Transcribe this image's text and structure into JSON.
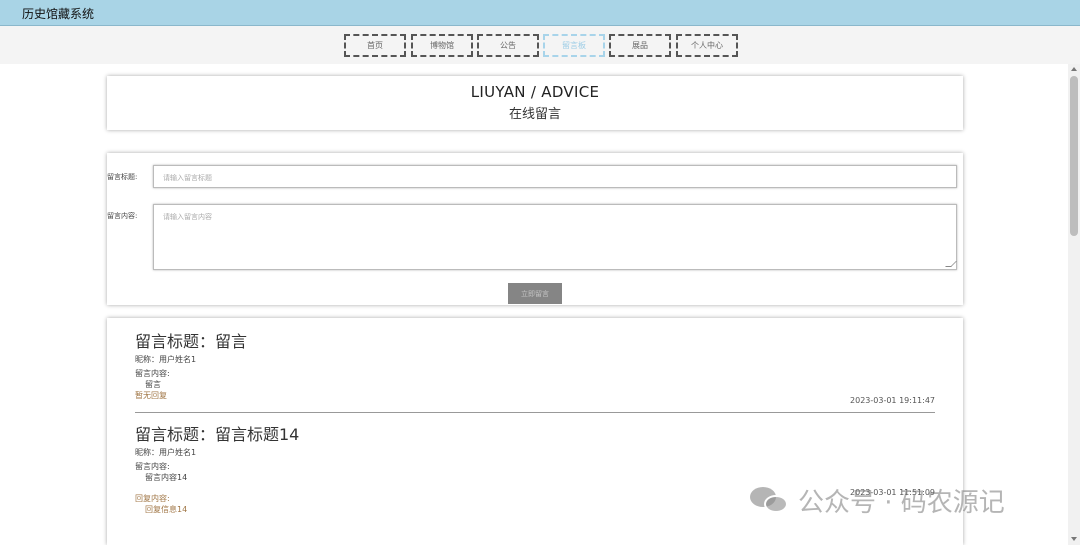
{
  "app": {
    "title": "历史馆藏系统"
  },
  "nav": {
    "items": [
      {
        "label": "首页"
      },
      {
        "label": "博物馆"
      },
      {
        "label": "公告"
      },
      {
        "label": "留言板"
      },
      {
        "label": "展品"
      },
      {
        "label": "个人中心"
      }
    ],
    "active": "留言板"
  },
  "header": {
    "title_en": "LIUYAN / ADVICE",
    "title_cn": "在线留言"
  },
  "form": {
    "title_label": "留言标题:",
    "title_placeholder": "请输入留言标题",
    "content_label": "留言内容:",
    "content_placeholder": "请输入留言内容",
    "submit_label": "立即留言"
  },
  "messages": [
    {
      "title": "留言标题：留言",
      "nickname": "昵称：用户姓名1",
      "content_label": "留言内容:",
      "content": "留言",
      "reply_status": "暂无回复",
      "date": "2023-03-01 19:11:47"
    },
    {
      "title": "留言标题：留言标题14",
      "nickname": "昵称：用户姓名1",
      "content_label": "留言内容:",
      "content": "留言内容14",
      "reply_label": "回复内容:",
      "reply": "回复信息14",
      "date": "2023-03-01 11:51:09"
    }
  ],
  "watermark": {
    "text": "公众号 · 码农源记"
  },
  "colors": {
    "topbar": "#a9d4e6",
    "active_nav": "#9ccde6",
    "reply": "#a07645",
    "button": "#858585"
  }
}
